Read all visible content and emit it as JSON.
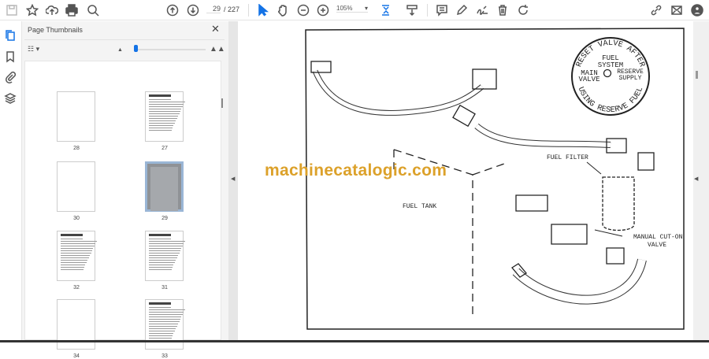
{
  "toolbar": {
    "page_current": "29",
    "page_total": "/ 227",
    "zoom": "105%",
    "icons": [
      "save-icon",
      "bookmark-star-icon",
      "cloud-upload-icon",
      "print-icon",
      "zoom-search-icon",
      "page-up-icon",
      "page-down-icon",
      "select-cursor-icon",
      "hand-tool-icon",
      "zoom-out-icon",
      "zoom-in-icon",
      "fit-page-icon",
      "scroll-mode-icon",
      "comment-icon",
      "highlight-pen-icon",
      "sign-icon",
      "delete-icon",
      "rotate-icon",
      "share-link-icon",
      "email-icon",
      "account-icon"
    ]
  },
  "sidebar": {
    "title": "Page Thumbnails",
    "thumbnails": [
      {
        "label": "28"
      },
      {
        "label": "27"
      },
      {
        "label": "30"
      },
      {
        "label": "29",
        "selected": true
      },
      {
        "label": "32"
      },
      {
        "label": "31"
      },
      {
        "label": "34"
      },
      {
        "label": "33"
      }
    ]
  },
  "document": {
    "watermark": "machinecatalogic.com",
    "labels": {
      "fuel_filter": "FUEL FILTER",
      "fuel_tank": "FUEL TANK",
      "cutoff_1": "MANUAL CUT-ON",
      "cutoff_2": "VALVE",
      "dial_top": "RESET VALVE AFTER",
      "dial_bottom": "USING RESERVE FUEL",
      "dial_fuel": "FUEL",
      "dial_system": "SYSTEM",
      "dial_main": "MAIN",
      "dial_valve": "VALVE",
      "dial_reserve": "RESERVE",
      "dial_supply": "SUPPLY"
    }
  }
}
